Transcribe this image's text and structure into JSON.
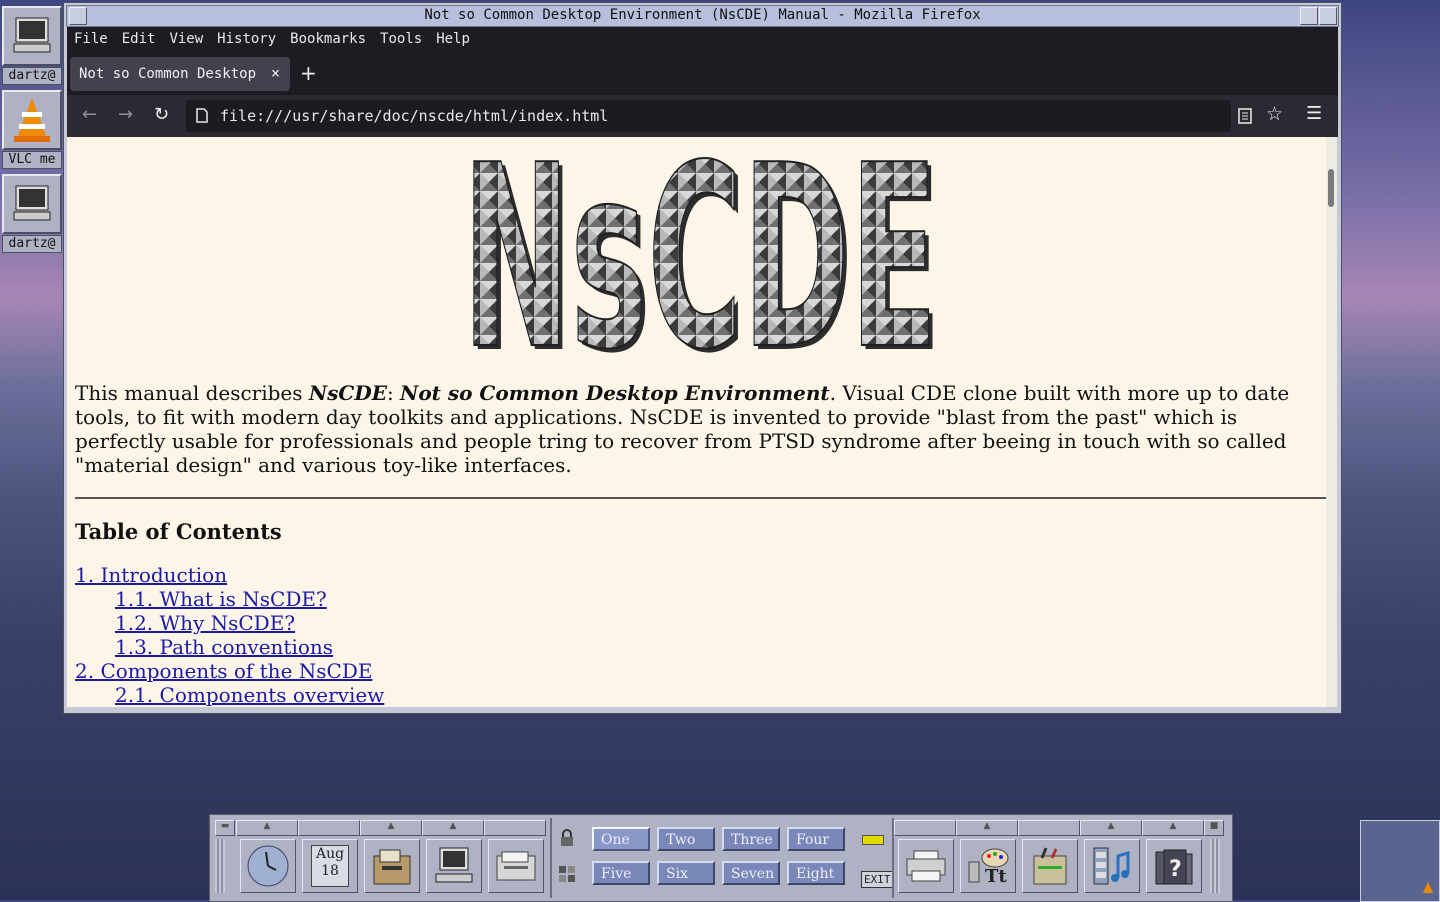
{
  "desktop_icons": [
    {
      "label": "dartz@",
      "icon": "computer-icon"
    },
    {
      "label": "VLC me",
      "icon": "vlc-cone-icon"
    },
    {
      "label": "dartz@",
      "icon": "computer-icon"
    }
  ],
  "window": {
    "title": "Not so Common Desktop Environment (NsCDE) Manual - Mozilla Firefox",
    "menu": [
      "File",
      "Edit",
      "View",
      "History",
      "Bookmarks",
      "Tools",
      "Help"
    ],
    "tab": {
      "title": "Not so Common Desktop",
      "close": "×"
    },
    "new_tab": "+",
    "url": "file:///usr/share/doc/nscde/html/index.html"
  },
  "page": {
    "logo_text": "NsCDE",
    "intro_prefix": "This manual describes ",
    "intro_bold_italic1": "NsCDE",
    "intro_colon": ": ",
    "intro_bold_italic2": "Not so Common Desktop Environment",
    "intro_rest": ". Visual CDE clone built with more up to date tools, to fit with modern day toolkits and applications. NsCDE is invented to provide \"blast from the past\" which is perfectly usable for professionals and people tring to recover from PTSD syndrome after beeing in touch with so called \"material design\" and various toy-like interfaces.",
    "toc_heading": "Table of Contents",
    "toc": [
      {
        "label": "1. Introduction",
        "level": 0
      },
      {
        "label": "1.1. What is NsCDE?",
        "level": 1
      },
      {
        "label": "1.2. Why NsCDE?",
        "level": 1
      },
      {
        "label": "1.3. Path conventions",
        "level": 1
      },
      {
        "label": "2. Components of the NsCDE",
        "level": 0
      },
      {
        "label": "2.1. Components overview",
        "level": 1
      }
    ]
  },
  "panel": {
    "date_month": "Aug",
    "date_day": "18",
    "workspaces": [
      "One",
      "Two",
      "Three",
      "Four",
      "Five",
      "Six",
      "Seven",
      "Eight"
    ],
    "active_workspace": "One",
    "exit_label": "EXIT"
  },
  "colors": {
    "menubar": "#1d1c22",
    "page_bg": "#fdf6e8",
    "link": "#1a1aa6",
    "panel": "#aeb2c3",
    "workspace": "#7a87b9"
  }
}
